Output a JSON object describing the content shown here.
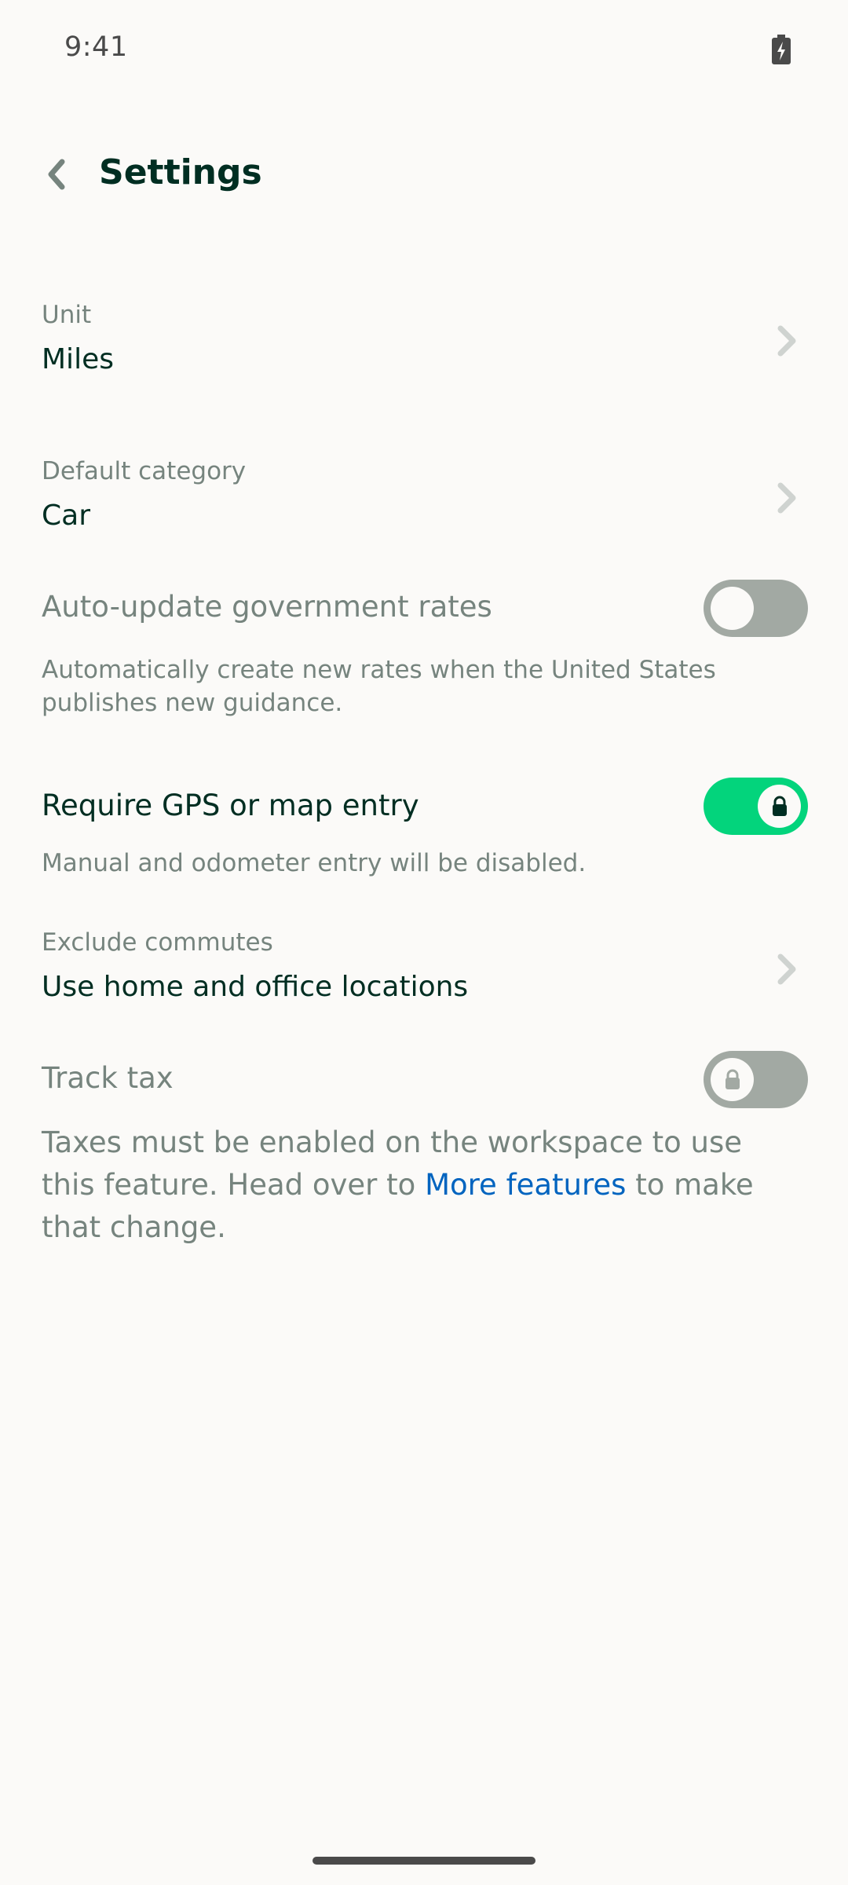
{
  "status_bar": {
    "time": "9:41",
    "battery_icon": "battery-charging-icon"
  },
  "header": {
    "back_icon": "chevron-left-icon",
    "title": "Settings"
  },
  "unit": {
    "label": "Unit",
    "value": "Miles"
  },
  "default_category": {
    "label": "Default category",
    "value": "Car"
  },
  "auto_update_rates": {
    "title": "Auto-update government rates",
    "description": "Automatically create new rates when the United States publishes new guidance.",
    "enabled": false
  },
  "require_gps": {
    "title": "Require GPS or map entry",
    "description": "Manual and odometer entry will be disabled.",
    "enabled": true,
    "locked": true
  },
  "exclude_commutes": {
    "label": "Exclude commutes",
    "value": "Use home and office locations"
  },
  "track_tax": {
    "title": "Track tax",
    "enabled": false,
    "locked": true,
    "note_before": "Taxes must be enabled on the workspace to use this feature. Head over to ",
    "link_text": "More features",
    "note_after": " to make that change."
  },
  "colors": {
    "toggle_on": "#03d47c",
    "toggle_off": "#a2a9a3",
    "link": "#0164bf",
    "text_primary": "#002e22",
    "text_secondary": "#76847e"
  }
}
